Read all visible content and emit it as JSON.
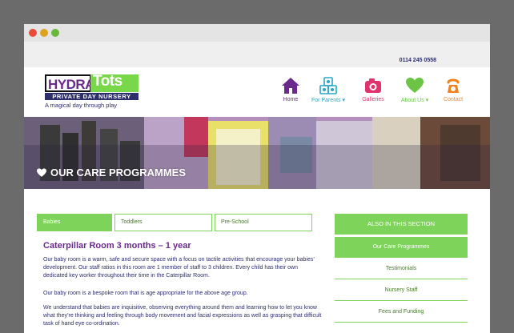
{
  "phone": "0114 245 0558",
  "logo": {
    "part1": "HYDRA",
    "part2": "Tots",
    "subtitle": "PRIVATE DAY NURSERY",
    "tagline": "A magical day through play"
  },
  "nav": [
    {
      "label": "Home",
      "icon": "house-icon",
      "color": "#6a2a8c"
    },
    {
      "label": "For Parents ▾",
      "icon": "blocks-icon",
      "color": "#2aa5c4"
    },
    {
      "label": "Galleries",
      "icon": "camera-icon",
      "color": "#e0336b"
    },
    {
      "label": "About Us ▾",
      "icon": "heart-icon",
      "color": "#6cc445"
    },
    {
      "label": "Contact",
      "icon": "telephone-icon",
      "color": "#f0821e"
    }
  ],
  "hero": {
    "title": "OUR CARE PROGRAMMES"
  },
  "tabs": [
    "Babies",
    "Toddlers",
    "Pre-School"
  ],
  "content": {
    "heading": "Caterpillar Room 3 months – 1 year",
    "paragraphs": [
      "Our baby room is a warm, safe and secure space with a focus on tactile activities that encourage your babies’ development. Our staff ratios in this room are 1 member of staff to 3 children. Every child has their own dedicated key worker throughout their time in the Caterpillar Room.",
      "Our baby room is a bespoke room that is age appropriate for the above age group.",
      "We understand that babies are inquisitive, observing everything around them and learning how to let you know what they’re thinking and feeling through body movement and facial expressions as well as grasping that difficult task of hand eye co-ordination."
    ]
  },
  "sidebar": {
    "title": "ALSO IN THIS SECTION",
    "items": [
      "Our Care Programmes",
      "Testimonials",
      "Nursery Staff",
      "Fees and Funding"
    ]
  },
  "colors": {
    "green": "#7ed35a",
    "purple": "#6a2a8c",
    "navy": "#2d2f6b"
  }
}
